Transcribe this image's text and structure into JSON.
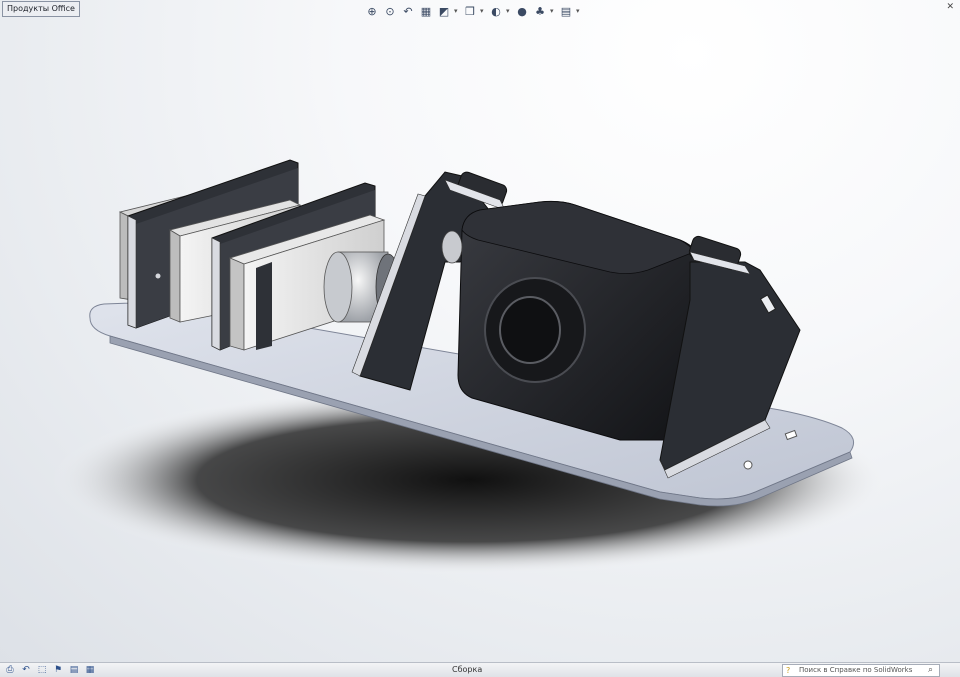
{
  "office_tab": {
    "label": "Продукты Office"
  },
  "view_toolbar": {
    "buttons": [
      {
        "icon": "zoom-to-fit-icon",
        "glyph": "⊕"
      },
      {
        "icon": "zoom-to-area-icon",
        "glyph": "⊙"
      },
      {
        "icon": "previous-view-icon",
        "glyph": "↶"
      },
      {
        "icon": "section-view-icon",
        "glyph": "▦"
      },
      {
        "icon": "view-orientation-icon",
        "glyph": "◩"
      },
      {
        "icon": "display-style-icon",
        "glyph": "❒"
      },
      {
        "icon": "hide-show-items-icon",
        "glyph": "◐"
      },
      {
        "icon": "edit-appearance-icon",
        "glyph": "●"
      },
      {
        "icon": "apply-scene-icon",
        "glyph": "♣"
      },
      {
        "icon": "view-settings-icon",
        "glyph": "▤"
      }
    ]
  },
  "status_bar": {
    "center_text": "Сборка",
    "help_placeholder": "Поиск в Справке по SolidWorks",
    "icons": [
      "print-icon",
      "undo-icon",
      "select-icon",
      "traffic-light-icon",
      "file-properties-icon",
      "options-icon"
    ]
  },
  "colors": {
    "plate": "#c9cfdb",
    "plate_edge": "#8d94a6",
    "dark_part": "#2a2d33",
    "camera": "#1b1c1f",
    "servo_light": "#e9eaea"
  }
}
